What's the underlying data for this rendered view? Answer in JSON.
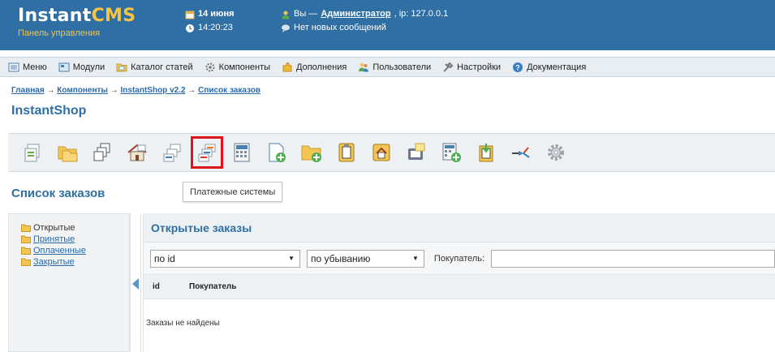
{
  "header": {
    "logo_main": "Instant",
    "logo_accent": "CMS",
    "logo_sub": "Панель управления",
    "date": "14 июня",
    "time": "14:20:23",
    "user_prefix": "Вы — ",
    "user_name": "Администратор",
    "ip": ", ip: 127.0.0.1",
    "messages": "Нет новых сообщений"
  },
  "menu": [
    {
      "label": "Меню",
      "icon": "menu-icon"
    },
    {
      "label": "Модули",
      "icon": "modules-icon"
    },
    {
      "label": "Каталог статей",
      "icon": "catalog-icon"
    },
    {
      "label": "Компоненты",
      "icon": "components-icon"
    },
    {
      "label": "Дополнения",
      "icon": "plugins-icon"
    },
    {
      "label": "Пользователи",
      "icon": "users-icon"
    },
    {
      "label": "Настройки",
      "icon": "settings-icon"
    },
    {
      "label": "Документация",
      "icon": "help-icon"
    }
  ],
  "breadcrumb": {
    "items": [
      "Главная",
      "Компоненты",
      "InstantShop v2.2",
      "Список заказов"
    ],
    "separator": " → "
  },
  "page_title": "InstantShop",
  "toolbar": {
    "tooltip": "Платежные системы",
    "buttons": [
      "items-icon",
      "categories-icon",
      "vendors-icon",
      "delivery-icon",
      "orders-icon",
      "payment-systems-icon",
      "discounts-icon",
      "add-item-icon",
      "add-category-icon",
      "add-field-icon",
      "add-vendor-icon",
      "import-icon",
      "price-icon",
      "export-icon",
      "tools-icon",
      "config-icon"
    ],
    "active_index": 5
  },
  "section_title": "Список заказов",
  "sidebar": {
    "items": [
      {
        "label": "Открытые",
        "link": false
      },
      {
        "label": "Принятые",
        "link": true
      },
      {
        "label": "Оплаченные",
        "link": true
      },
      {
        "label": "Закрытые",
        "link": true
      }
    ]
  },
  "panel": {
    "title": "Открытые заказы",
    "sort_field": "по id",
    "sort_order": "по убыванию",
    "buyer_label": "Покупатель:",
    "columns": [
      "id",
      "Покупатель"
    ],
    "empty_text": "Заказы не найдены"
  },
  "colors": {
    "header_bg": "#2f6fa3",
    "accent": "#f5c443",
    "active_outline": "#e0141b"
  }
}
